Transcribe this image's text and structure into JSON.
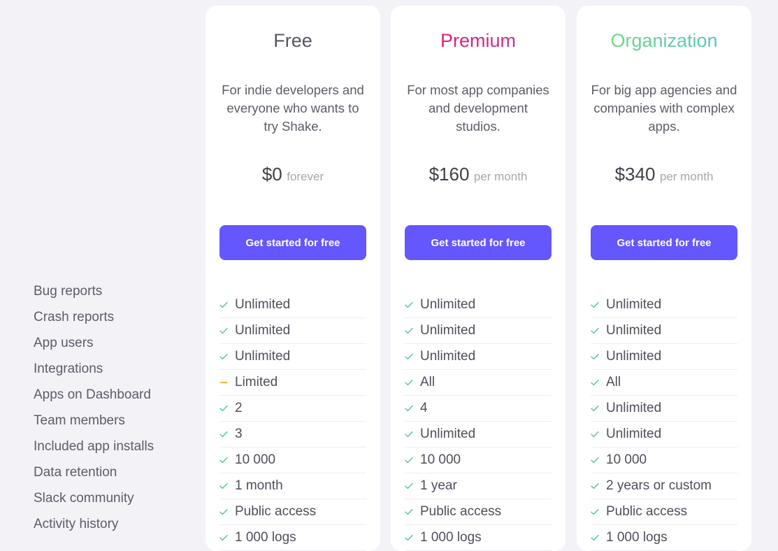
{
  "feature_labels": [
    "Bug reports",
    "Crash reports",
    "App users",
    "Integrations",
    "Apps on Dashboard",
    "Team members",
    "Included app installs",
    "Data retention",
    "Slack community",
    "Activity history"
  ],
  "colors": {
    "accent_button": "#6457fd",
    "check": "#4fc98a",
    "limited": "#f7b33c",
    "premium_gradient": [
      "#f0125e",
      "#b53ea1"
    ],
    "organization_gradient": [
      "#6ddc7e",
      "#5cbfc4"
    ]
  },
  "plans": [
    {
      "name": "Free",
      "description": "For indie developers and everyone who wants to try Shake.",
      "price": "$0",
      "period": "forever",
      "cta": "Get started for free",
      "features": [
        {
          "icon": "check-icon",
          "value": "Unlimited"
        },
        {
          "icon": "check-icon",
          "value": "Unlimited"
        },
        {
          "icon": "check-icon",
          "value": "Unlimited"
        },
        {
          "icon": "dash-icon",
          "value": "Limited"
        },
        {
          "icon": "check-icon",
          "value": "2"
        },
        {
          "icon": "check-icon",
          "value": "3"
        },
        {
          "icon": "check-icon",
          "value": "10 000"
        },
        {
          "icon": "check-icon",
          "value": "1 month"
        },
        {
          "icon": "check-icon",
          "value": "Public access"
        },
        {
          "icon": "check-icon",
          "value": "1 000 logs"
        }
      ]
    },
    {
      "name": "Premium",
      "description": "For most app companies and development studios.",
      "price": "$160",
      "period": "per month",
      "cta": "Get started for free",
      "features": [
        {
          "icon": "check-icon",
          "value": "Unlimited"
        },
        {
          "icon": "check-icon",
          "value": "Unlimited"
        },
        {
          "icon": "check-icon",
          "value": "Unlimited"
        },
        {
          "icon": "check-icon",
          "value": "All"
        },
        {
          "icon": "check-icon",
          "value": "4"
        },
        {
          "icon": "check-icon",
          "value": "Unlimited"
        },
        {
          "icon": "check-icon",
          "value": "10 000"
        },
        {
          "icon": "check-icon",
          "value": "1 year"
        },
        {
          "icon": "check-icon",
          "value": "Public access"
        },
        {
          "icon": "check-icon",
          "value": "1 000 logs"
        }
      ]
    },
    {
      "name": "Organization",
      "description": "For big app agencies and companies with complex apps.",
      "price": "$340",
      "period": "per month",
      "cta": "Get started for free",
      "features": [
        {
          "icon": "check-icon",
          "value": "Unlimited"
        },
        {
          "icon": "check-icon",
          "value": "Unlimited"
        },
        {
          "icon": "check-icon",
          "value": "Unlimited"
        },
        {
          "icon": "check-icon",
          "value": "All"
        },
        {
          "icon": "check-icon",
          "value": "Unlimited"
        },
        {
          "icon": "check-icon",
          "value": "Unlimited"
        },
        {
          "icon": "check-icon",
          "value": "10 000"
        },
        {
          "icon": "check-icon",
          "value": "2 years or custom"
        },
        {
          "icon": "check-icon",
          "value": "Public access"
        },
        {
          "icon": "check-icon",
          "value": "1 000 logs"
        }
      ]
    }
  ]
}
